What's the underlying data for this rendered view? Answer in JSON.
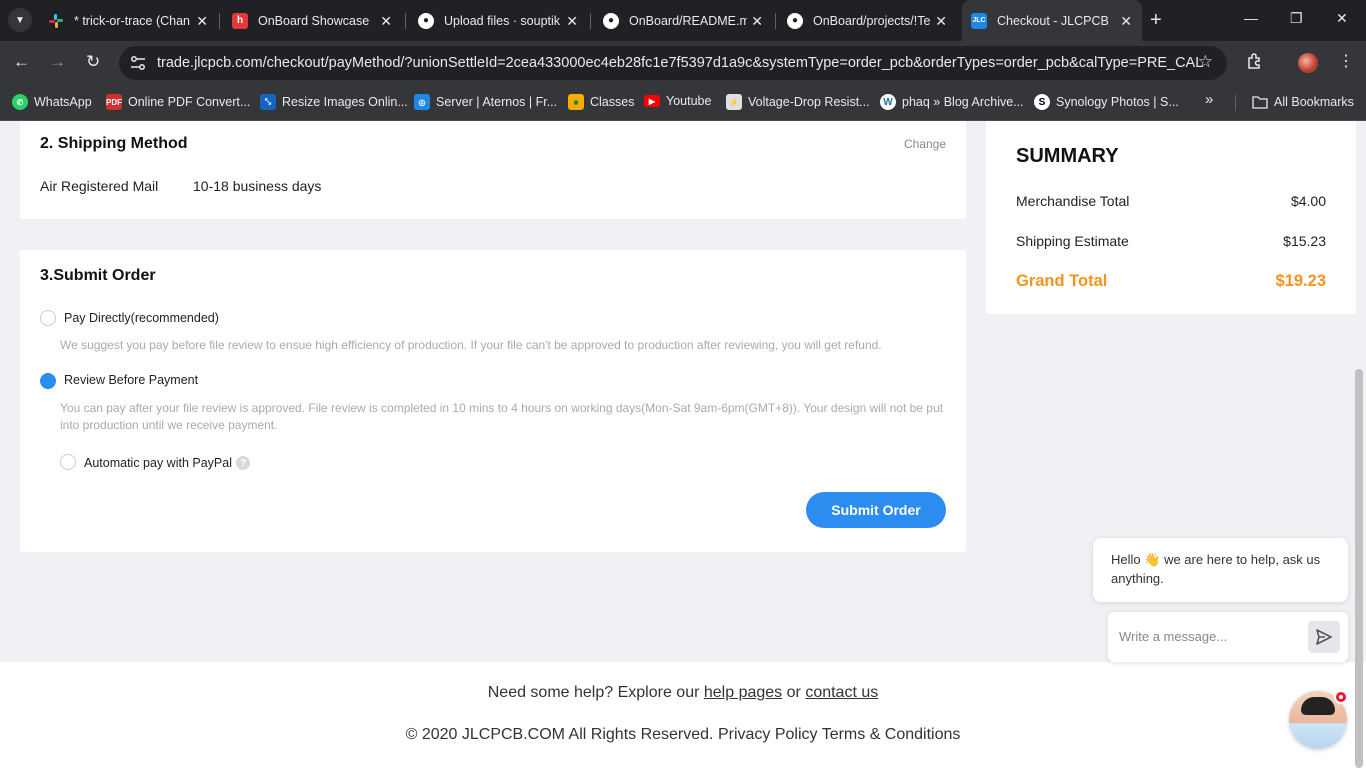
{
  "browser": {
    "tabs": [
      {
        "label": "* trick-or-trace (Chan",
        "icon": "slack-icon",
        "color": "#e01e5a"
      },
      {
        "label": "OnBoard Showcase",
        "icon": "h-logo-icon",
        "color": "#e53935"
      },
      {
        "label": "Upload files · souptik",
        "icon": "github-icon",
        "color": "#ffffff"
      },
      {
        "label": "OnBoard/README.m",
        "icon": "github-icon",
        "color": "#ffffff"
      },
      {
        "label": "OnBoard/projects/!Te",
        "icon": "github-icon",
        "color": "#ffffff"
      },
      {
        "label": "Checkout - JLCPCB",
        "icon": "jlc-icon",
        "color": "#1e88e5"
      }
    ],
    "url": "trade.jlcpcb.com/checkout/payMethod/?unionSettleId=2cea433000ec4eb28fc1e7f5397d1a9c&systemType=order_pcb&orderTypes=order_pcb&calType=PRE_CAL",
    "bookmarks": [
      {
        "label": "WhatsApp",
        "icon": "whatsapp-icon"
      },
      {
        "label": "Online PDF Convert...",
        "icon": "pdf-icon"
      },
      {
        "label": "Resize Images Onlin...",
        "icon": "resize-icon"
      },
      {
        "label": "Server | Aternos | Fr...",
        "icon": "aternos-icon"
      },
      {
        "label": "Classes",
        "icon": "classroom-icon"
      },
      {
        "label": "Youtube",
        "icon": "youtube-icon"
      },
      {
        "label": "Voltage-Drop Resist...",
        "icon": "voltage-icon"
      },
      {
        "label": "phaq » Blog Archive...",
        "icon": "wordpress-icon"
      },
      {
        "label": "Synology Photos | S...",
        "icon": "synology-icon"
      }
    ],
    "bookmarks_more": "»",
    "all_bookmarks": "All Bookmarks"
  },
  "shipping": {
    "title": "2. Shipping Method",
    "change": "Change",
    "method": "Air Registered Mail",
    "time": "10-18 business days"
  },
  "submit": {
    "title": "3.Submit Order",
    "options": [
      {
        "label": "Pay Directly(recommended)",
        "desc": "We suggest you pay before file review to ensue high efficiency of production. If your file can't be approved to production after reviewing, you will get refund.",
        "checked": false
      },
      {
        "label": "Review Before Payment",
        "desc": "You can pay after your file review is approved. File review is completed in 10 mins to 4 hours on working days(Mon-Sat 9am-6pm(GMT+8)). Your design will not be put into production until we receive payment.",
        "checked": true
      }
    ],
    "paypal_label": "Automatic pay with PayPal",
    "help_glyph": "?",
    "button": "Submit Order"
  },
  "summary": {
    "title": "SUMMARY",
    "merch_label": "Merchandise Total",
    "merch_value": "$4.00",
    "ship_label": "Shipping Estimate",
    "ship_value": "$15.23",
    "grand_label": "Grand Total",
    "grand_value": "$19.23",
    "accent": "#f5931e"
  },
  "footer": {
    "help_prefix": "Need some help? Explore our",
    "help_link": "help pages",
    "help_or": "or",
    "contact_link": "contact us",
    "copyright": "© 2020 JLCPCB.COM All Rights Reserved.",
    "privacy": "Privacy Policy",
    "terms": "Terms & Conditions"
  },
  "chat": {
    "greeting_a": "Hello",
    "wave_emoji": "👋",
    "greeting_b": "we are here to help, ask us anything.",
    "placeholder": "Write a message..."
  }
}
